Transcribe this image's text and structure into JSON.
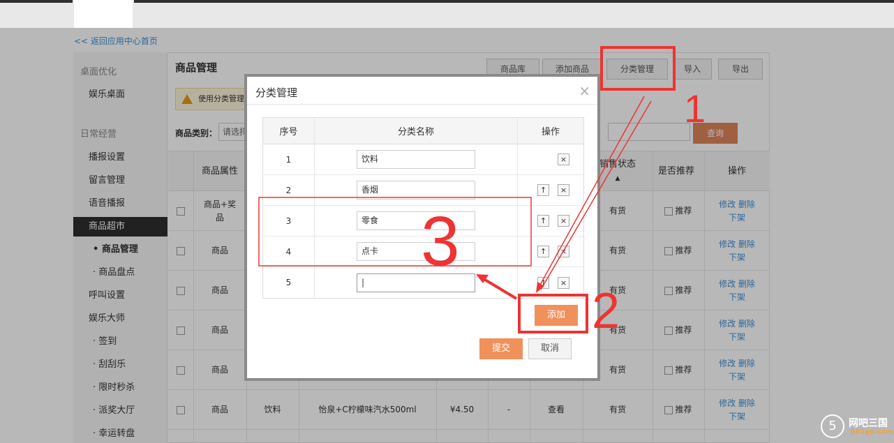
{
  "nav": {
    "back_link": "<< 返回应用中心首页"
  },
  "sidebar": {
    "items": [
      {
        "label": "桌面优化",
        "kind": "group"
      },
      {
        "label": "娱乐桌面",
        "kind": "item"
      },
      {
        "label": "日常经营",
        "kind": "group"
      },
      {
        "label": "播报设置",
        "kind": "item"
      },
      {
        "label": "留言管理",
        "kind": "item"
      },
      {
        "label": "语音播报",
        "kind": "item"
      },
      {
        "label": "商品超市",
        "kind": "active"
      },
      {
        "label": "• 商品管理",
        "kind": "sub-bold"
      },
      {
        "label": "· 商品盘点",
        "kind": "sub"
      },
      {
        "label": "呼叫设置",
        "kind": "item"
      },
      {
        "label": "娱乐大师",
        "kind": "item"
      },
      {
        "label": "· 签到",
        "kind": "sub"
      },
      {
        "label": "· 刮刮乐",
        "kind": "sub"
      },
      {
        "label": "· 限时秒杀",
        "kind": "sub"
      },
      {
        "label": "· 派奖大厅",
        "kind": "sub"
      },
      {
        "label": "· 幸运转盘",
        "kind": "sub"
      }
    ]
  },
  "main": {
    "title": "商品管理",
    "toolbar": [
      "商品库",
      "添加商品",
      "分类管理",
      "导入",
      "导出"
    ],
    "warning": "使用分类管理",
    "filter_label": "商品类别：",
    "filter_placeholder": "请选择",
    "query_label": "查询",
    "columns": {
      "attr": "商品属性",
      "sale_status": "销售状态",
      "sort_arrow": "▲",
      "recommend": "是否推荐",
      "ops": "操作"
    },
    "rows": [
      {
        "attr": "商品+奖品",
        "status": "有货",
        "rec": "推荐",
        "category": "",
        "name": "",
        "price": "",
        "dash": "",
        "view": ""
      },
      {
        "attr": "商品",
        "status": "有货",
        "rec": "推荐",
        "category": "",
        "name": "",
        "price": "",
        "dash": "",
        "view": ""
      },
      {
        "attr": "商品",
        "status": "有货",
        "rec": "推荐",
        "category": "",
        "name": "",
        "price": "",
        "dash": "",
        "view": ""
      },
      {
        "attr": "商品",
        "status": "有货",
        "rec": "推荐",
        "category": "",
        "name": "",
        "price": "",
        "dash": "",
        "view": ""
      },
      {
        "attr": "商品",
        "status": "有货",
        "rec": "推荐",
        "category": "",
        "name": "",
        "price": "",
        "dash": "",
        "view": ""
      },
      {
        "attr": "商品",
        "status": "有货",
        "rec": "推荐",
        "category": "饮料",
        "name": "怡泉+C柠檬味汽水500ml",
        "price": "¥4.50",
        "dash": "-",
        "view": "查看"
      }
    ],
    "op_links": {
      "edit": "修改",
      "delete": "删除",
      "off": "下架"
    }
  },
  "modal": {
    "title": "分类管理",
    "close": "×",
    "headers": {
      "idx": "序号",
      "name": "分类名称",
      "op": "操作"
    },
    "categories": [
      {
        "idx": "1",
        "name": "饮料"
      },
      {
        "idx": "2",
        "name": "香烟"
      },
      {
        "idx": "3",
        "name": "零食"
      },
      {
        "idx": "4",
        "name": "点卡"
      },
      {
        "idx": "5",
        "name": "|"
      }
    ],
    "up_icon": "↑",
    "del_icon": "×",
    "add_label": "添加",
    "submit_label": "提交",
    "cancel_label": "取消"
  },
  "watermark": {
    "text1": "网吧三国",
    "text2": "583go.com",
    "mark": "5"
  },
  "annotations": {
    "n1": "1",
    "n2": "2",
    "n3": "3",
    "color": "#ee3333"
  }
}
